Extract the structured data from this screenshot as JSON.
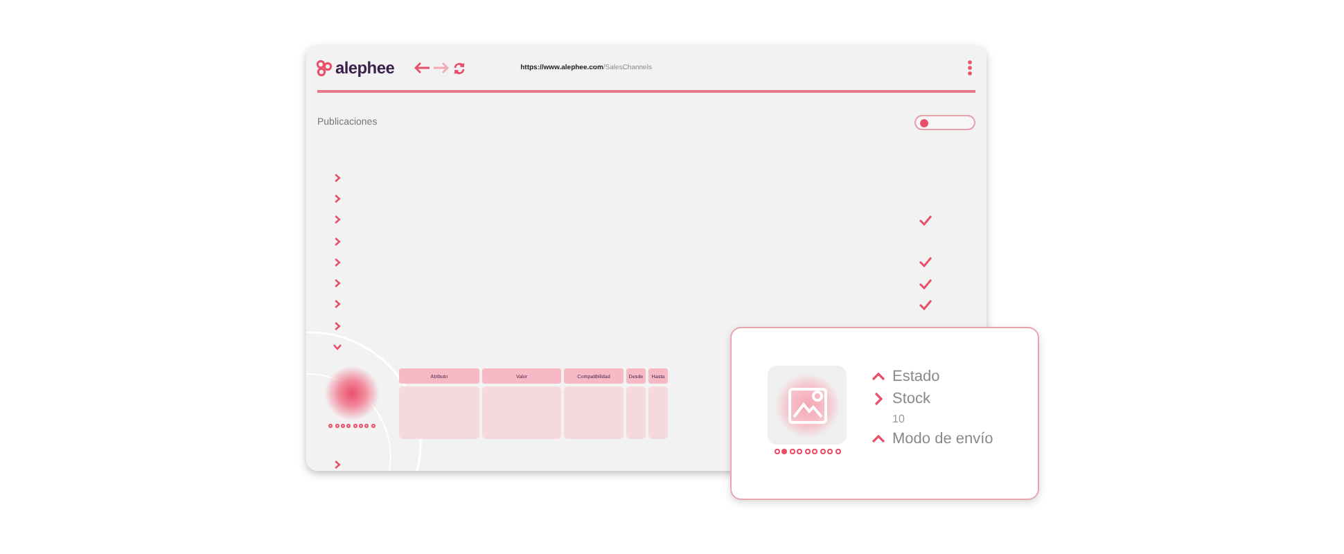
{
  "browser": {
    "logo": "alephee",
    "url_host": "https://www.alephee.com",
    "url_path": "/SalesChannels"
  },
  "page": {
    "title": "Publicaciones",
    "toggle": {
      "on": false
    }
  },
  "rows": [
    {
      "expanded": false,
      "checked": false
    },
    {
      "expanded": false,
      "checked": false
    },
    {
      "expanded": false,
      "checked": true
    },
    {
      "expanded": false,
      "checked": false
    },
    {
      "expanded": false,
      "checked": true
    },
    {
      "expanded": false,
      "checked": true
    },
    {
      "expanded": false,
      "checked": true
    },
    {
      "expanded": false,
      "checked": false
    },
    {
      "expanded": true,
      "checked": false,
      "detail": {
        "dots": [
          {
            "selected": false
          },
          {
            "selected": false
          },
          {
            "selected": false
          },
          {
            "selected": false
          },
          {
            "selected": false
          },
          {
            "selected": false
          },
          {
            "selected": false
          },
          {
            "selected": false
          }
        ],
        "columns": [
          "Atributo",
          "Valor",
          "Compatibilidad",
          "Desde",
          "Hasta"
        ]
      }
    },
    {
      "expanded": false,
      "checked": false
    }
  ],
  "card": {
    "dots": [
      {
        "selected": false
      },
      {
        "selected": true
      },
      {
        "selected": false
      },
      {
        "selected": false
      },
      {
        "selected": false
      },
      {
        "selected": false
      },
      {
        "selected": false
      },
      {
        "selected": false
      },
      {
        "selected": false
      }
    ],
    "fields": [
      {
        "label": "Estado",
        "expanded": true
      },
      {
        "label": "Stock",
        "expanded": false,
        "value": "10"
      },
      {
        "label": "Modo de envío",
        "expanded": true
      }
    ]
  }
}
